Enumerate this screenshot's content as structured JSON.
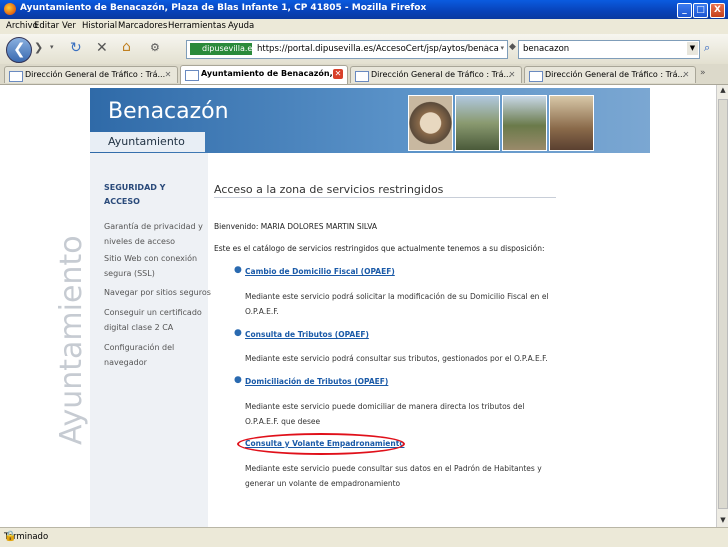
{
  "window": {
    "title": "Ayuntamiento de Benacazón, Plaza de Blas Infante 1, CP 41805 - Mozilla Firefox",
    "min_label": "_",
    "max_label": "□",
    "close_label": "X"
  },
  "menu": {
    "items": [
      "Archivo",
      "Editar",
      "Ver",
      "Historial",
      "Marcadores",
      "Herramientas",
      "Ayuda"
    ]
  },
  "navbar": {
    "site_badge": "dipusevilla.es",
    "url": "https://portal.dipusevilla.es/AccesoCert/jsp/aytos/benaca",
    "search_value": "benacazon"
  },
  "tabs": [
    {
      "label": "Dirección General de Tráfico : Trá...",
      "active": false
    },
    {
      "label": "Ayuntamiento de Benacazón,...",
      "active": true
    },
    {
      "label": "Dirección General de Tráfico : Trá...",
      "active": false
    },
    {
      "label": "Dirección General de Tráfico : Trá...",
      "active": false
    }
  ],
  "site": {
    "title": "Benacazón",
    "subtitle": "Ayuntamiento",
    "watermark": "Ayuntamiento"
  },
  "sidebar": {
    "heading_line1": "SEGURIDAD Y",
    "heading_line2": "ACCESO",
    "items": [
      {
        "line1": "Garantía de privacidad y",
        "line2": "niveles de acceso"
      },
      {
        "line1": "Sitio Web con conexión",
        "line2": "segura (SSL)"
      },
      {
        "line1": "Navegar por sitios seguros",
        "line2": ""
      },
      {
        "line1": "Conseguir un certificado",
        "line2": "digital clase 2 CA"
      },
      {
        "line1": "Configuración del",
        "line2": "navegador"
      }
    ]
  },
  "main": {
    "title": "Acceso a la zona de servicios restringidos",
    "welcome": "Bienvenido: MARIA DOLORES MARTIN SILVA",
    "intro": "Este es el catálogo de servicios restringidos que actualmente tenemos a su disposición:",
    "services": [
      {
        "name": "Cambio de Domicilio Fiscal (OPAEF)",
        "line1": "Mediante este servicio podrá solicitar la modificación de su Domicilio Fiscal en el",
        "line2": "O.P.A.E.F."
      },
      {
        "name": "Consulta de Tributos (OPAEF)",
        "line1": "Mediante este servicio podrá consultar sus tributos, gestionados por el O.P.A.E.F.",
        "line2": ""
      },
      {
        "name": "Domiciliación de Tributos (OPAEF)",
        "line1": "Mediante este servicio puede domiciliar de manera directa los tributos del",
        "line2": "O.P.A.E.F. que desee"
      },
      {
        "name": "Consulta y Volante Empadronamiento",
        "line1": "Mediante este servicio puede consultar sus datos en el Padrón de Habitantes y",
        "line2": "generar un volante de empadronamiento"
      }
    ]
  },
  "status": {
    "text": "Terminado"
  },
  "colors": {
    "banner": "#2f6aa8",
    "link": "#1a5aa8",
    "highlight_circle": "#e0101a"
  }
}
